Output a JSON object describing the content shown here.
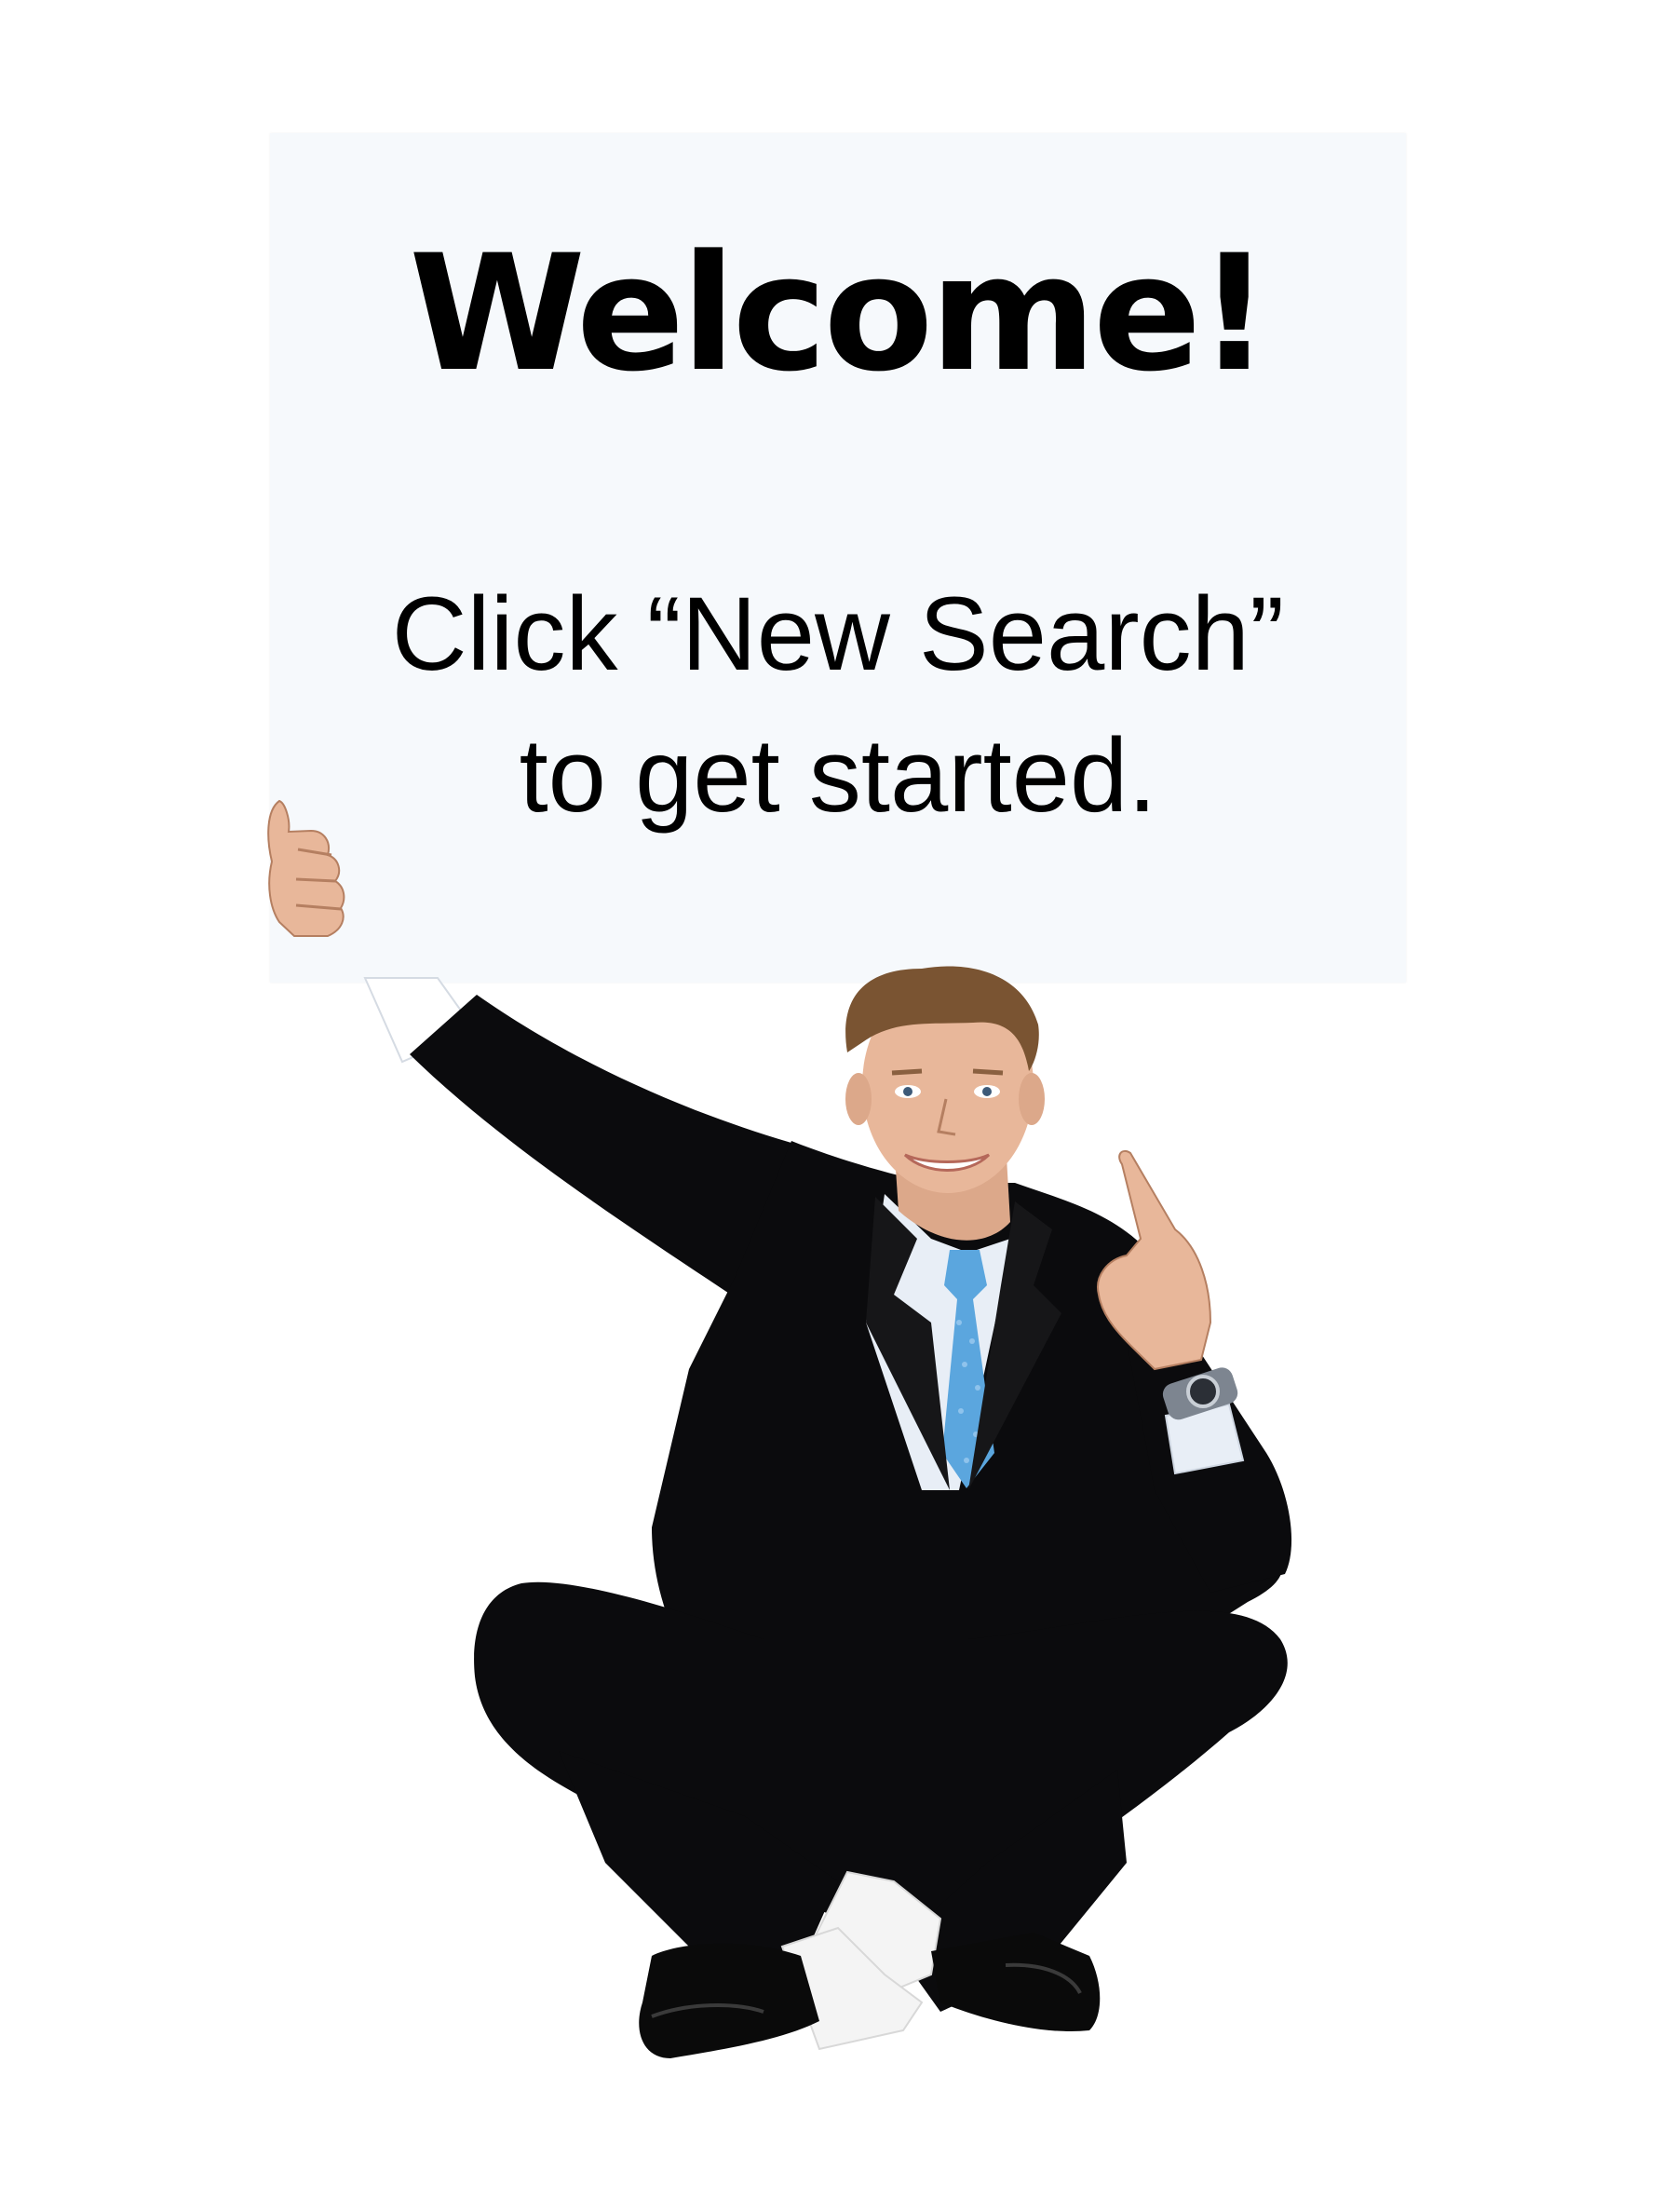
{
  "sign": {
    "heading": "Welcome!",
    "instruction_line1": "Click “New Search”",
    "instruction_line2": "to get started."
  },
  "colors": {
    "card": "#f6f9fc",
    "text": "#000000",
    "suit": "#0b0b0d",
    "shirt": "#e8eef6",
    "tie": "#5ba6de",
    "skin": "#e8b79a",
    "hair": "#7a5432",
    "sock": "#f4f4f4"
  },
  "illustration": {
    "subject": "smiling-businessman-sitting-cross-legged-holding-sign-and-pointing-up"
  }
}
